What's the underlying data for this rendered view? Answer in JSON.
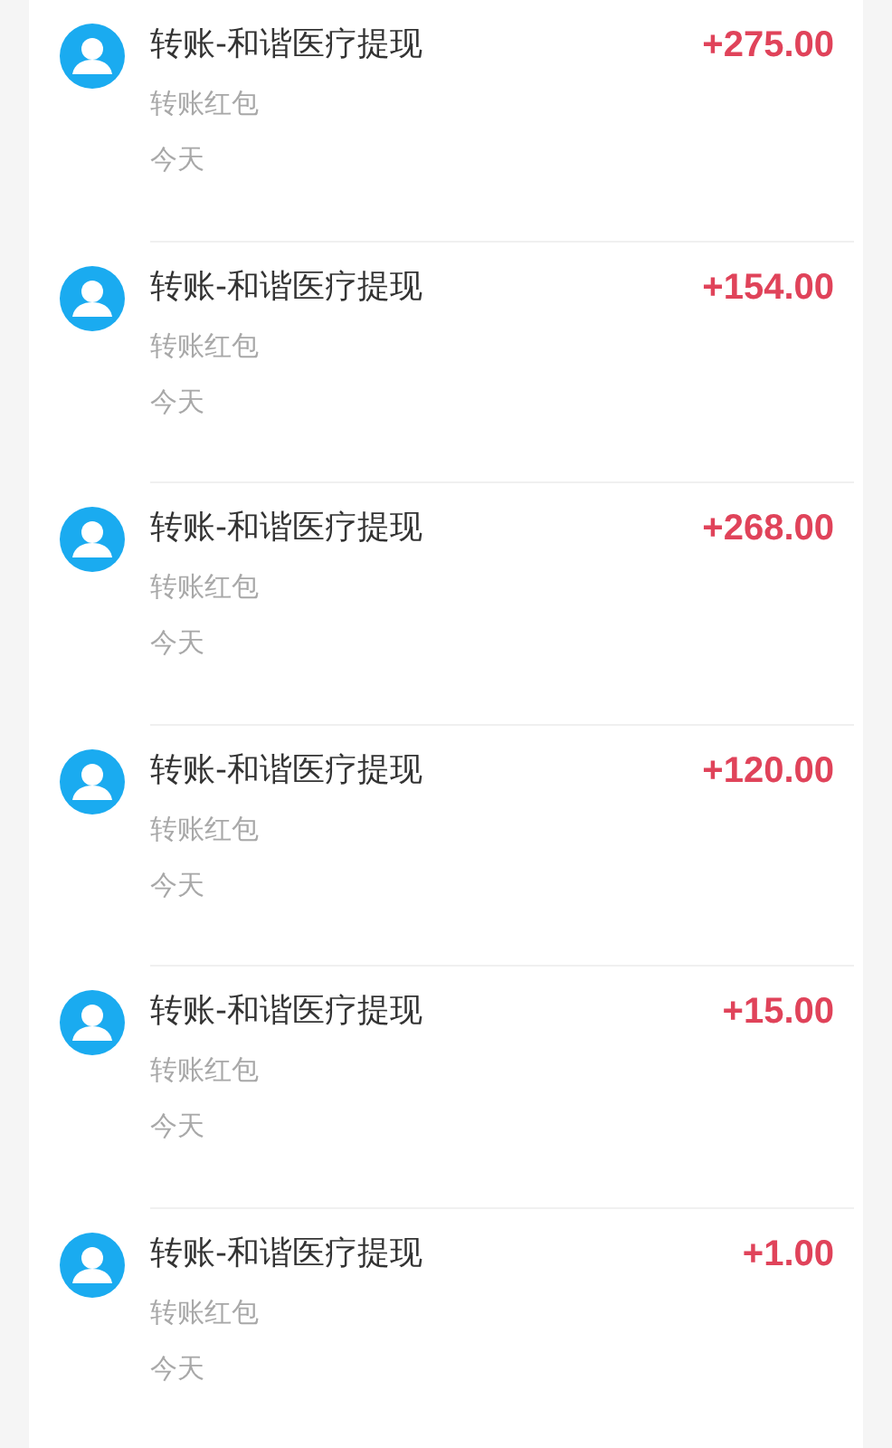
{
  "transactions": [
    {
      "title": "转账-和谐医疗提现",
      "subtitle": "转账红包",
      "date": "今天",
      "amount": "+275.00"
    },
    {
      "title": "转账-和谐医疗提现",
      "subtitle": "转账红包",
      "date": "今天",
      "amount": "+154.00"
    },
    {
      "title": "转账-和谐医疗提现",
      "subtitle": "转账红包",
      "date": "今天",
      "amount": "+268.00"
    },
    {
      "title": "转账-和谐医疗提现",
      "subtitle": "转账红包",
      "date": "今天",
      "amount": "+120.00"
    },
    {
      "title": "转账-和谐医疗提现",
      "subtitle": "转账红包",
      "date": "今天",
      "amount": "+15.00"
    },
    {
      "title": "转账-和谐医疗提现",
      "subtitle": "转账红包",
      "date": "今天",
      "amount": "+1.00"
    }
  ]
}
